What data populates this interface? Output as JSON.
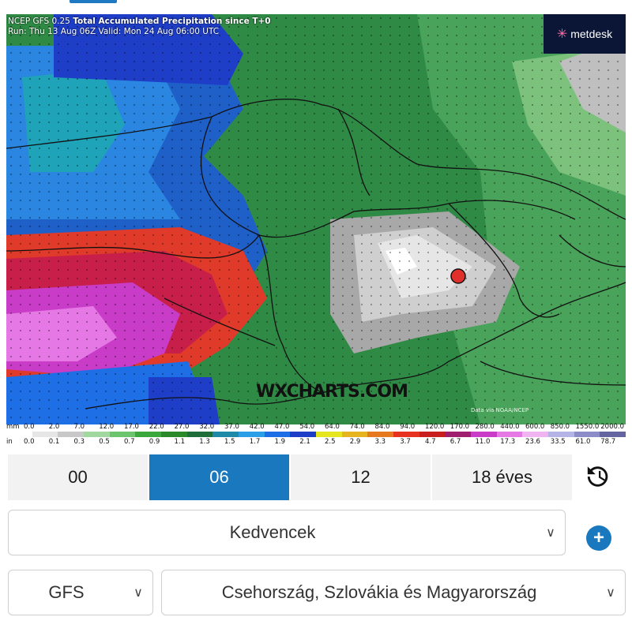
{
  "map": {
    "header_line1_prefix": "NCEP GFS 0.25",
    "header_line1_title": "Total Accumulated Precipitation since T+0",
    "header_line2": "Run: Thu 13 Aug 06Z Valid: Mon 24 Aug 06:00 UTC",
    "logo_text": "metdesk",
    "watermark": "WXCHARTS.COM",
    "credit": "Data via NOAA/NCEP",
    "marker_color": "#e0302b"
  },
  "legend": {
    "mm_unit": "mm",
    "mm_values": [
      "0.0",
      "2.0",
      "7.0",
      "12.0",
      "17.0",
      "22.0",
      "27.0",
      "32.0",
      "37.0",
      "42.0",
      "47.0",
      "54.0",
      "64.0",
      "74.0",
      "84.0",
      "94.0",
      "120.0",
      "170.0",
      "280.0",
      "440.0",
      "600.0",
      "850.0",
      "1550.0",
      "2000.0"
    ],
    "in_unit": "in",
    "in_values": [
      "0.0",
      "0.1",
      "0.3",
      "0.5",
      "0.7",
      "0.9",
      "1.1",
      "1.3",
      "1.5",
      "1.7",
      "1.9",
      "2.1",
      "2.5",
      "2.9",
      "3.3",
      "3.7",
      "4.7",
      "6.7",
      "11.0",
      "17.3",
      "23.6",
      "33.5",
      "61.0",
      "78.7"
    ],
    "colors": [
      "#ffffff",
      "#e6e6e6",
      "#c8c8c8",
      "#a0d8a0",
      "#6cc46c",
      "#3aa83a",
      "#2a8a2a",
      "#1e6e3a",
      "#1e8aa8",
      "#2a9ee6",
      "#1e6ee6",
      "#1e3ec8",
      "#e6e61e",
      "#e6b41e",
      "#e6781e",
      "#e6321e",
      "#c81e1e",
      "#a01e6e",
      "#c83cc8",
      "#e678e6",
      "#f0b4f0",
      "#b4b4e6",
      "#8c8cc8",
      "#6464a0"
    ]
  },
  "time_tabs": [
    {
      "label": "00",
      "active": false
    },
    {
      "label": "06",
      "active": true
    },
    {
      "label": "12",
      "active": false
    },
    {
      "label": "18 éves",
      "active": false
    }
  ],
  "favorites": {
    "label": "Kedvencek"
  },
  "model_select": {
    "label": "GFS"
  },
  "region_select": {
    "label": "Csehország, Szlovákia és Magyarország"
  },
  "icons": {
    "history": "history-icon",
    "plus": "plus-icon",
    "chevron": "chevron-down-icon"
  }
}
